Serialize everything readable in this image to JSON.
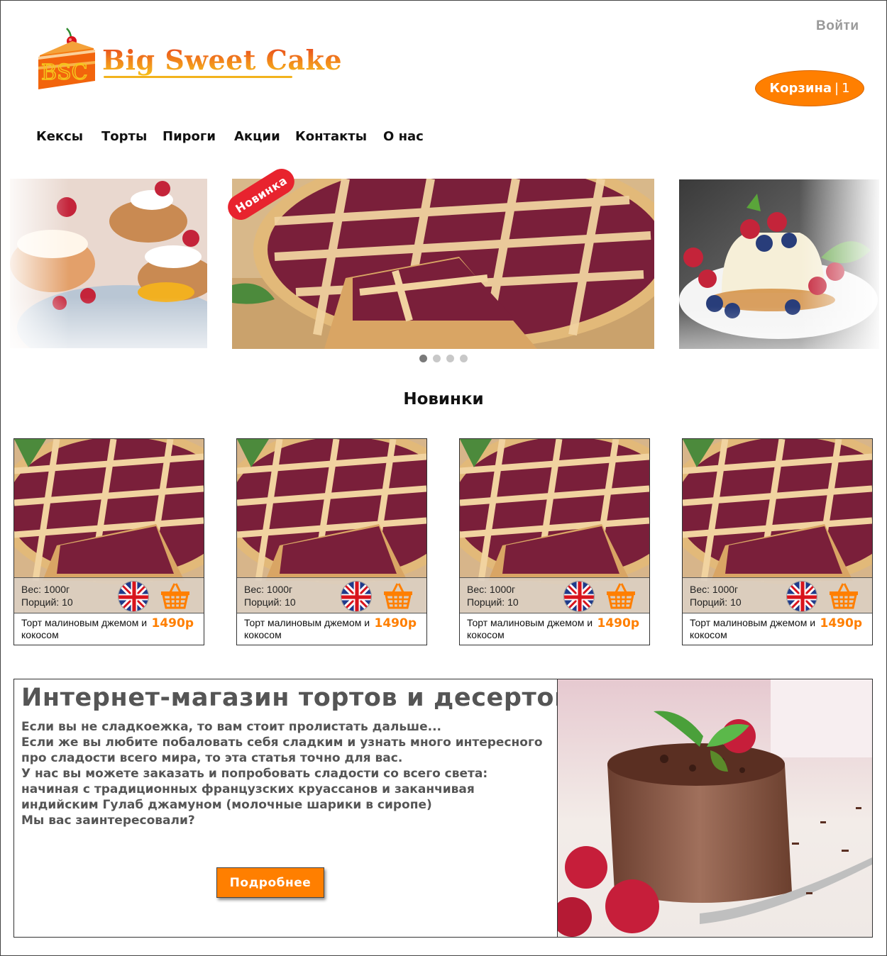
{
  "header": {
    "logo_text": "Big Sweet Cake",
    "logo_monogram": "BSC",
    "login_label": "Войти",
    "cart_label": "Корзина",
    "cart_separator": "|",
    "cart_count": "1"
  },
  "nav": {
    "items": [
      {
        "label": "Кексы"
      },
      {
        "label": "Торты"
      },
      {
        "label": "Пироги"
      },
      {
        "label": "Акции"
      },
      {
        "label": "Контакты"
      },
      {
        "label": "О нас"
      }
    ]
  },
  "carousel": {
    "badge": "Новинка",
    "slides_count": 4,
    "active_slide": 1
  },
  "new_section": {
    "title": "Новинки",
    "products": [
      {
        "weight": "Вес: 1000г",
        "portions": "Порций: 10",
        "name": "Торт малиновым джемом и кокосом",
        "price": "1490р"
      },
      {
        "weight": "Вес: 1000г",
        "portions": "Порций: 10",
        "name": "Торт малиновым джемом и кокосом",
        "price": "1490р"
      },
      {
        "weight": "Вес: 1000г",
        "portions": "Порций: 10",
        "name": "Торт малиновым джемом и кокосом",
        "price": "1490р"
      },
      {
        "weight": "Вес: 1000г",
        "portions": "Порций: 10",
        "name": "Торт малиновым джемом и кокосом",
        "price": "1490р"
      }
    ]
  },
  "about": {
    "title": "Интернет-магазин тортов и десертов",
    "text": "Если вы не сладкоежка, то вам стоит пролистать дальше...\nЕсли же вы любите побаловать себя сладким и узнать много интересного про сладости всего мира, то эта статья точно для вас.\nУ нас вы можете заказать и попробовать сладости со всего света: начиная с традиционных  французских круассанов и заканчивая индийским Гулаб джамуном (молочные шарики в сиропе)\nМы вас заинтересовали?",
    "button_label": "Подробнее"
  },
  "colors": {
    "accent": "#ff7f00",
    "badge": "#e8232e",
    "muted_text": "#555555",
    "login_text": "#999999"
  },
  "icons": [
    "cake-logo-icon",
    "uk-flag-icon",
    "basket-icon"
  ]
}
